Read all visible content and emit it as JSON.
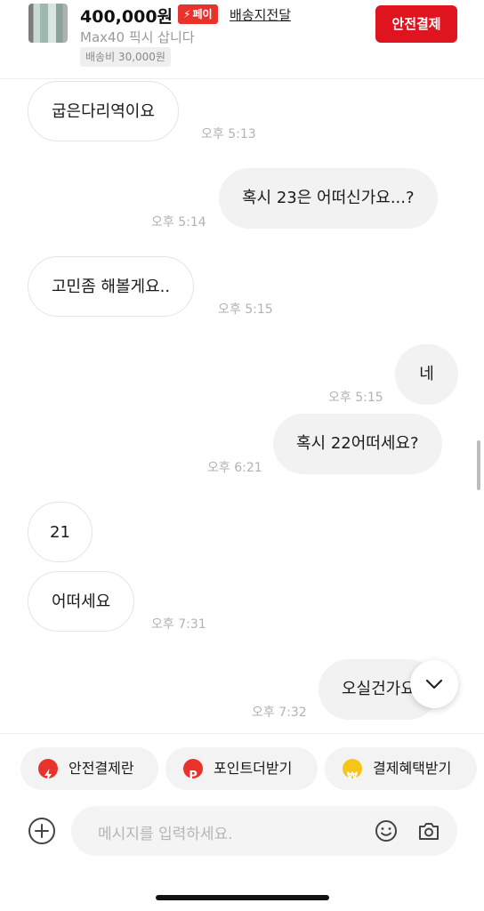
{
  "header": {
    "price": "400,000원",
    "pay_badge": "페이",
    "delivery_link": "배송지전달",
    "subtitle": "Max40 픽시 삽니다",
    "shipping_fee": "배송비 30,000원",
    "safe_pay_button": "안전결제"
  },
  "messages": [
    {
      "side": "in",
      "text": "굽은다리역이요",
      "time": "오후 5:13"
    },
    {
      "side": "out",
      "text": "혹시 23은 어떠신가요...?",
      "time": "오후 5:14"
    },
    {
      "side": "in",
      "text": "고민좀 해볼게요..",
      "time": "오후 5:15"
    },
    {
      "side": "out",
      "text": "네",
      "time": "오후 5:15"
    },
    {
      "side": "out",
      "text": "혹시 22어떠세요?",
      "time": "오후 6:21"
    },
    {
      "side": "in",
      "text": "21",
      "time": ""
    },
    {
      "side": "in",
      "text": "어떠세요",
      "time": "오후 7:31"
    },
    {
      "side": "out",
      "text": "오실건가요",
      "time": "오후 7:32"
    }
  ],
  "quick_actions": [
    {
      "label": "안전결제란",
      "icon": "lightning-icon",
      "color": "#e8332d"
    },
    {
      "label": "포인트더받기",
      "icon": "point-icon",
      "color": "#e8332d"
    },
    {
      "label": "결제혜택받기",
      "icon": "won-coin-icon",
      "color": "#f5c518"
    }
  ],
  "input": {
    "placeholder": "메시지를 입력하세요."
  },
  "colors": {
    "accent_red": "#e0141e",
    "incoming_bubble": "#ffffff",
    "outgoing_bubble": "#f2f2f2"
  }
}
